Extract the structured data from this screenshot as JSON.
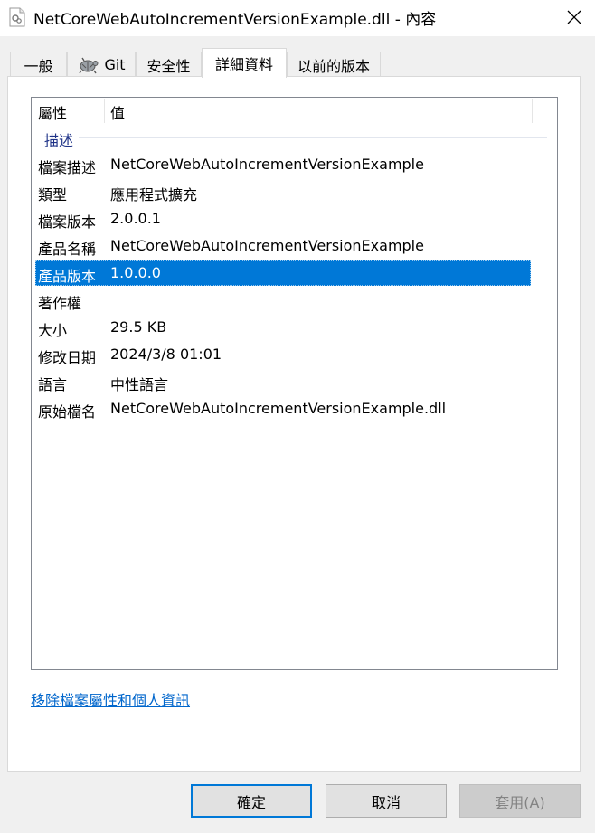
{
  "window": {
    "title": "NetCoreWebAutoIncrementVersionExample.dll - 內容",
    "file_icon": "document-file-icon",
    "close_icon": "close-icon"
  },
  "tabs": [
    {
      "label": "一般"
    },
    {
      "label": "Git",
      "icon": "tortoise-git-icon"
    },
    {
      "label": "安全性"
    },
    {
      "label": "詳細資料",
      "active": true
    },
    {
      "label": "以前的版本"
    }
  ],
  "details": {
    "columns": {
      "property": "屬性",
      "value": "值"
    },
    "group_label": "描述",
    "rows": [
      {
        "property": "檔案描述",
        "value": "NetCoreWebAutoIncrementVersionExample"
      },
      {
        "property": "類型",
        "value": "應用程式擴充"
      },
      {
        "property": "檔案版本",
        "value": "2.0.0.1"
      },
      {
        "property": "產品名稱",
        "value": "NetCoreWebAutoIncrementVersionExample"
      },
      {
        "property": "產品版本",
        "value": "1.0.0.0",
        "selected": true
      },
      {
        "property": "著作權",
        "value": ""
      },
      {
        "property": "大小",
        "value": "29.5 KB"
      },
      {
        "property": "修改日期",
        "value": "2024/3/8 01:01"
      },
      {
        "property": "語言",
        "value": "中性語言"
      },
      {
        "property": "原始檔名",
        "value": "NetCoreWebAutoIncrementVersionExample.dll"
      }
    ]
  },
  "remove_link": "移除檔案屬性和個人資訊",
  "buttons": {
    "ok": "確定",
    "cancel": "取消",
    "apply": "套用(A)"
  },
  "colors": {
    "selection": "#0078d7",
    "link": "#0066cc",
    "group": "#1e3287"
  }
}
